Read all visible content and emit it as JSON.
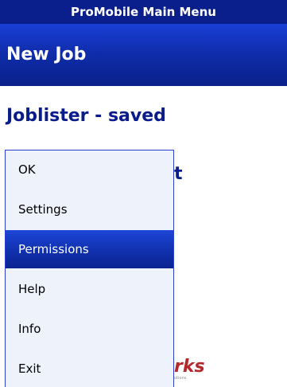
{
  "top_bar": {
    "title": "ProMobile Main Menu"
  },
  "header": {
    "title": "New Job"
  },
  "content": {
    "heading": "Joblister - saved",
    "partial_heading_visible": "t",
    "logo_partial_text": "rks",
    "logo_partial_subtext": "utions"
  },
  "menu": {
    "items": [
      {
        "label": "OK"
      },
      {
        "label": "Settings"
      },
      {
        "label": "Permissions",
        "selected": true
      },
      {
        "label": "Help"
      },
      {
        "label": "Info"
      },
      {
        "label": "Exit"
      }
    ]
  },
  "colors": {
    "top_bar": "#0b1f8c",
    "header": "#1a3fd6",
    "heading_text": "#0a1b8a",
    "menu_bg": "#eef2fb",
    "menu_border": "#2b3fd0",
    "selection": "#1d47d8",
    "logo": "#b3282d"
  }
}
